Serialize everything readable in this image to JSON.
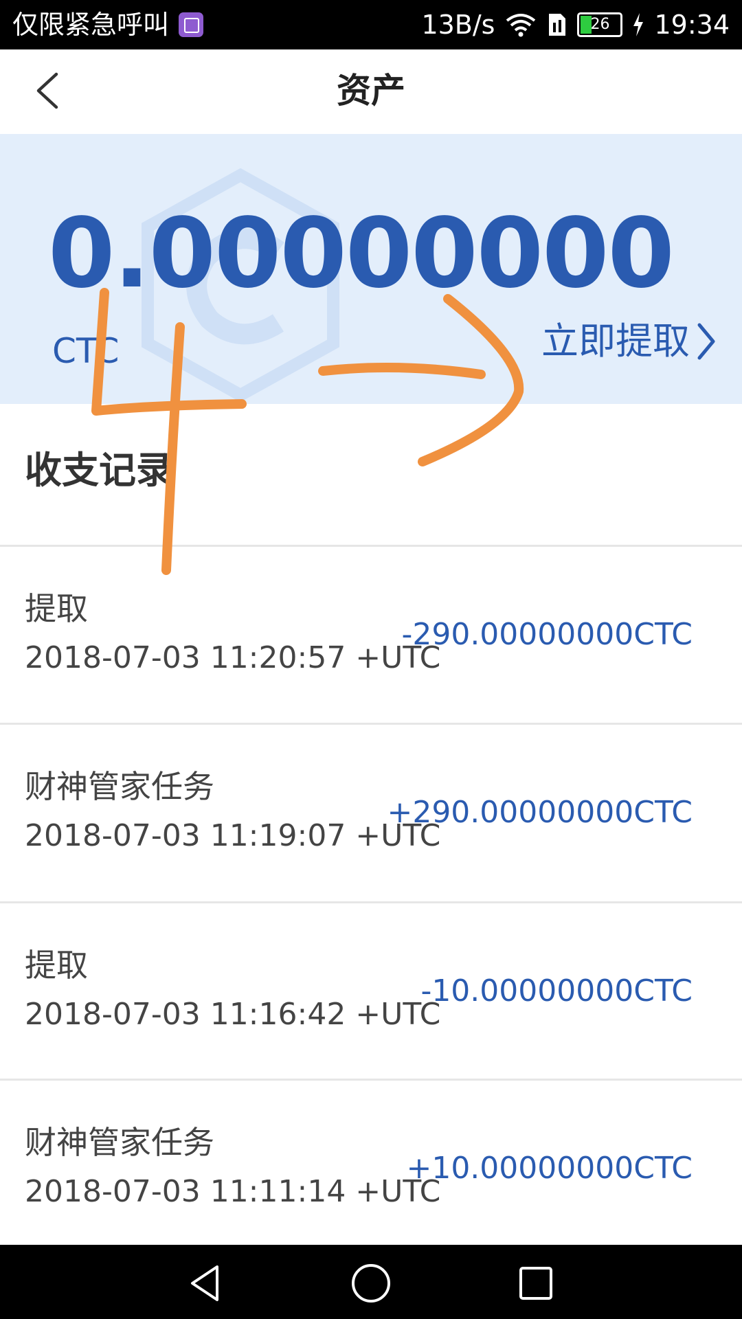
{
  "status_bar": {
    "left_text": "仅限紧急呼叫",
    "speed": "13B/s",
    "battery": "26",
    "time": "19:34"
  },
  "header": {
    "title": "资产"
  },
  "card": {
    "balance": "0.00000000",
    "currency": "CTC",
    "withdraw_label": "立即提取"
  },
  "records": {
    "title": "收支记录",
    "items": [
      {
        "label": "提取",
        "time": "2018-07-03 11:20:57 +UTC",
        "amount": "-290.00000000CTC"
      },
      {
        "label": "财神管家任务",
        "time": "2018-07-03 11:19:07 +UTC",
        "amount": "+290.00000000CTC"
      },
      {
        "label": "提取",
        "time": "2018-07-03 11:16:42 +UTC",
        "amount": "-10.00000000CTC"
      },
      {
        "label": "财神管家任务",
        "time": "2018-07-03 11:11:14 +UTC",
        "amount": "+10.00000000CTC"
      }
    ]
  },
  "annotation": {
    "handwritten": "4",
    "color": "#f0913f"
  },
  "colors": {
    "accent": "#2a5bb0",
    "card_bg": "#e3eefb"
  },
  "icons": {
    "back": "chevron-left-icon",
    "withdraw_arrow": "chevron-right-icon",
    "nav_back": "triangle-back-icon",
    "nav_home": "circle-home-icon",
    "nav_recent": "square-recent-icon"
  }
}
